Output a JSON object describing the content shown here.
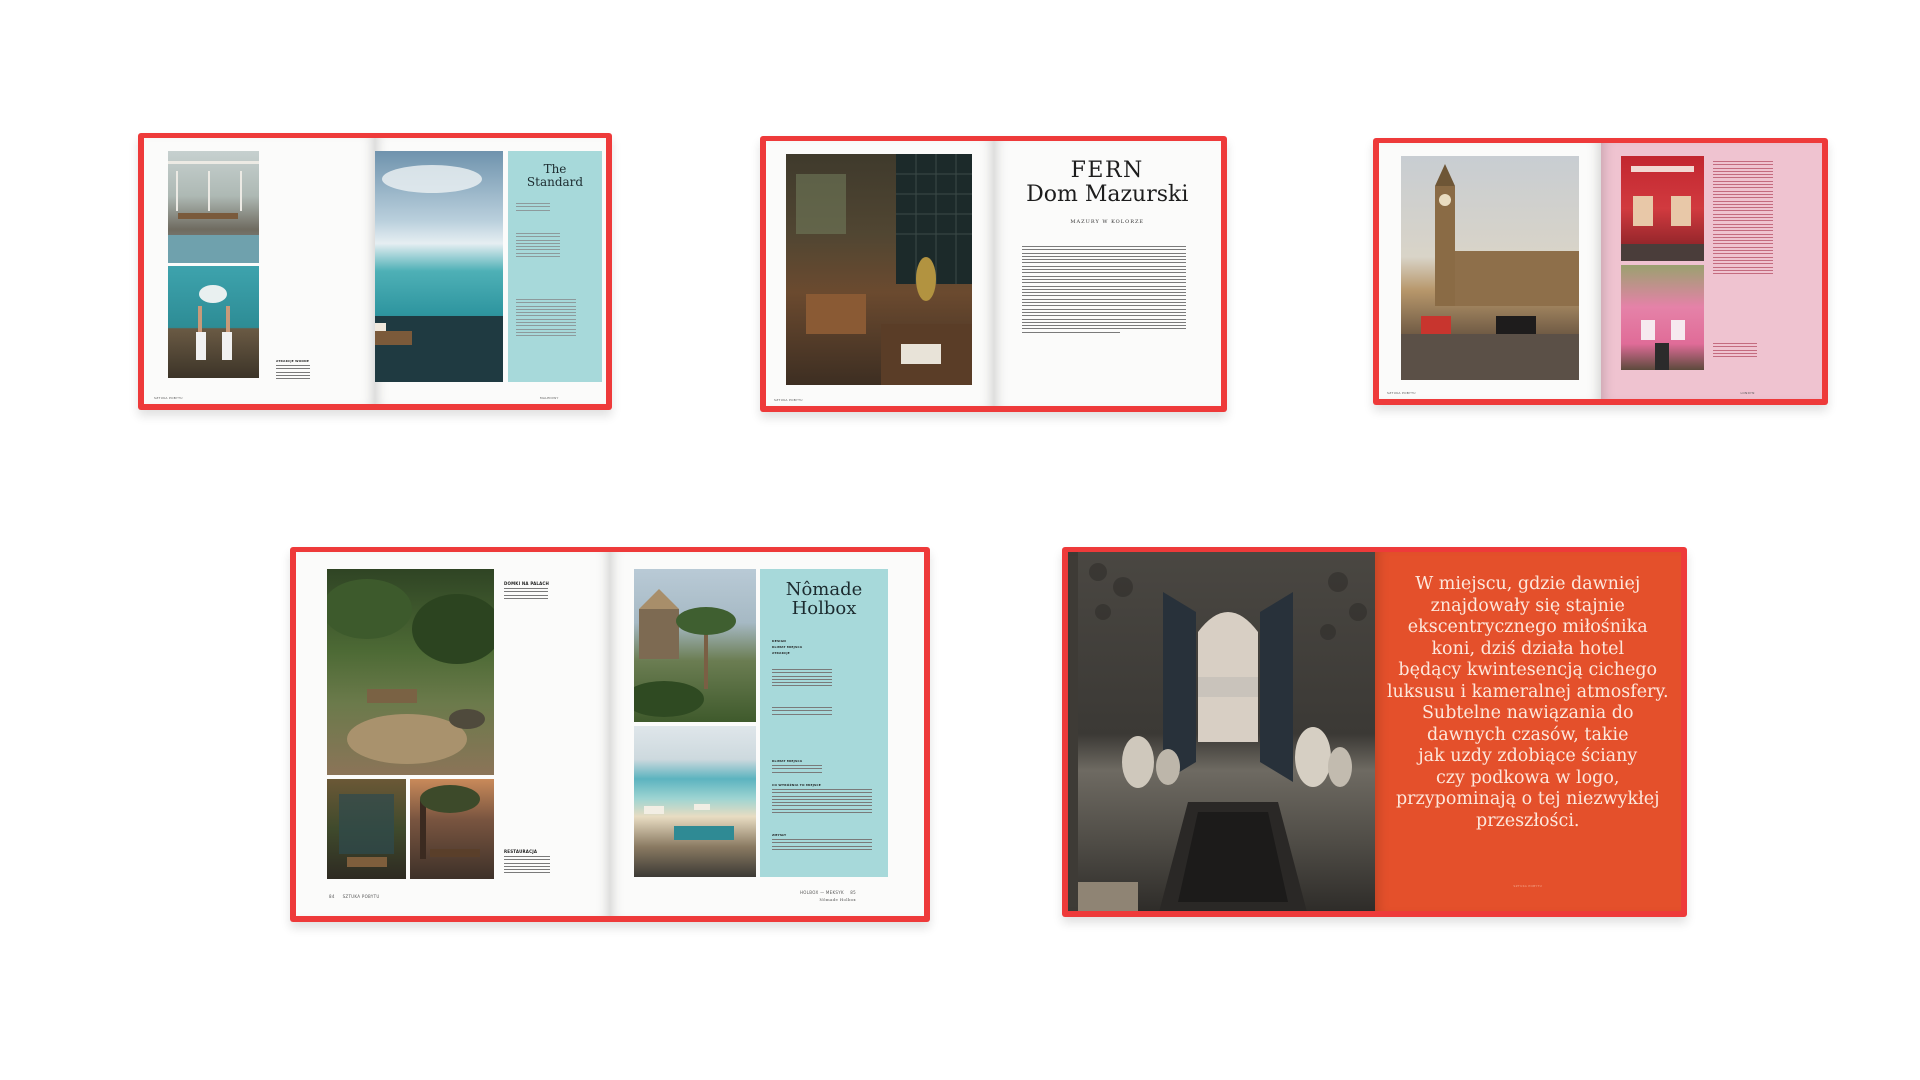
{
  "book1": {
    "panel_title": "The Standard",
    "folio_left": "SZTUKA POBYTU",
    "folio_right": "MALEDIWY"
  },
  "book2": {
    "title_line1": "FERN",
    "title_line2": "Dom Mazurski",
    "subtitle": "MAZURY W KOLORZE",
    "folio_left": "SZTUKA POBYTU"
  },
  "book3": {
    "folio_left": "SZTUKA POBYTU",
    "folio_right": "LONDYN"
  },
  "book4": {
    "panel_title_line1": "Nômade",
    "panel_title_line2": "Holbox",
    "labels": [
      "DESIGN",
      "KLIMAT MIEJSCA",
      "ATRAKCJE"
    ],
    "left_heading": "DOMKI NA PALACH",
    "restaurant_heading": "RESTAURACJA",
    "klimat_heading": "KLIMAT MIEJSCA",
    "dlaczego_heading": "CO WYRÓŻNIA TO MIEJSCE",
    "zmysly_heading": "ZMYSŁY",
    "folio_left_num": "84",
    "folio_left": "SZTUKA POBYTU",
    "folio_right": "HOLBOX — MEKSYK",
    "folio_right_sub": "Nômade Holbox",
    "folio_right_num": "85"
  },
  "book5": {
    "quote": "W miejscu, gdzie dawniej znajdowały się stajnie ekscentrycznego miłośnika koni, dziś działa hotel będący kwintesencją cichego luksusu i kameralnej atmosfery. Subtelne nawiązania do dawnych czasów, takie jak uzdy zdobiące ściany czy podkowa w logo, przypominają o tej niezwykłej przeszłości.",
    "quote_lines": [
      "W miejscu, gdzie dawniej",
      "znajdowały się stajnie",
      "ekscentrycznego miłośnika",
      "koni, dziś działa hotel",
      "będący kwintesencją cichego",
      "luksusu i kameralnej atmosfery.",
      "Subtelne nawiązania do",
      "dawnych czasów, takie",
      "jak uzdy zdobiące ściany",
      "czy podkowa w logo,",
      "przypominają o tej niezwykłej",
      "przeszłości."
    ],
    "folio": "SZTUKA POBYTU"
  },
  "colors": {
    "cover_red": "#ee3a3a",
    "panel_teal": "#a7d9da",
    "pink_page": "#efc3d0",
    "quote_page": "#e4502b"
  }
}
